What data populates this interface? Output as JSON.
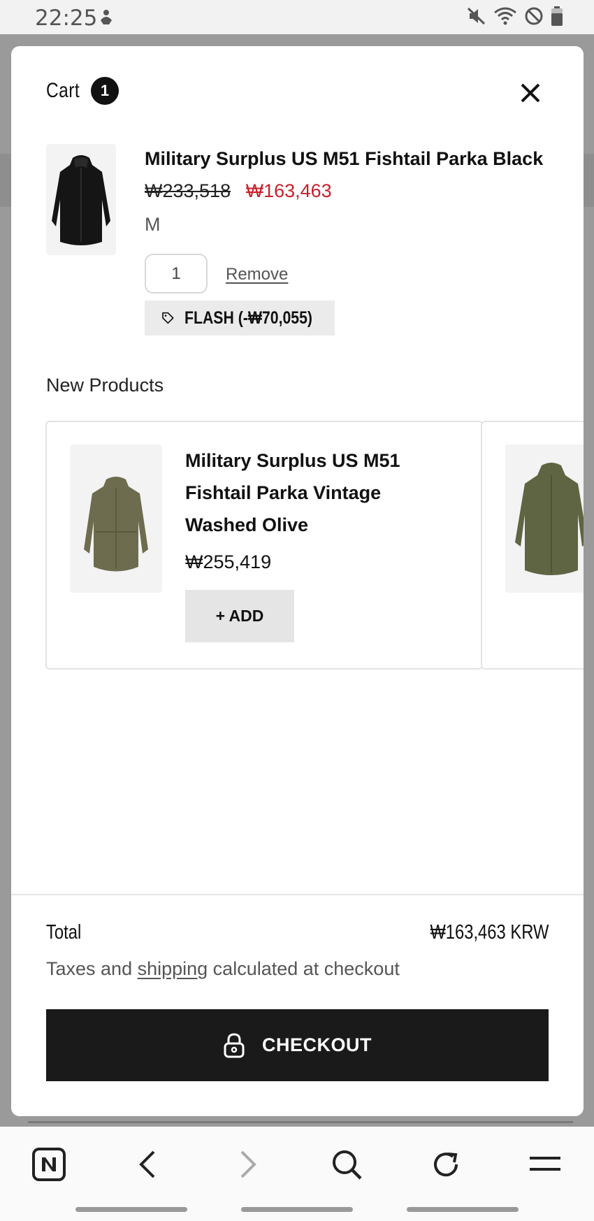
{
  "status_bar": {
    "time": "22:25",
    "icons": [
      "mute-icon",
      "wifi-icon",
      "do-not-disturb-icon",
      "battery-icon"
    ]
  },
  "cart": {
    "title": "Cart",
    "count": "1",
    "close_icon": "close-icon"
  },
  "cart_item": {
    "name": "Military Surplus US M51 Fishtail Parka Black",
    "original_price": "₩233,518",
    "sale_price": "₩163,463",
    "variant": "M",
    "quantity": "1",
    "remove_label": "Remove",
    "discount_label": "FLASH (-₩70,055)",
    "discount_icon": "tag-icon"
  },
  "new_products": {
    "title": "New Products",
    "items": [
      {
        "name": "Military Surplus US M51 Fishtail Parka Vintage Washed Olive",
        "price": "₩255,419",
        "add_label": "+ ADD"
      }
    ]
  },
  "summary": {
    "total_label": "Total",
    "total_value": "₩163,463 KRW",
    "tax_prefix": "Taxes and ",
    "tax_link": "shipping",
    "tax_suffix": " calculated at checkout",
    "checkout_label": "CHECKOUT",
    "checkout_icon": "lock-icon"
  },
  "browser_nav": {
    "buttons": [
      "naver-home-icon",
      "back-icon",
      "forward-icon",
      "search-icon",
      "reload-icon",
      "menu-icon"
    ]
  },
  "colors": {
    "sale_price": "#c8202a",
    "checkout_bg": "#1a1a1a",
    "overlay": "#9a9a9a"
  }
}
